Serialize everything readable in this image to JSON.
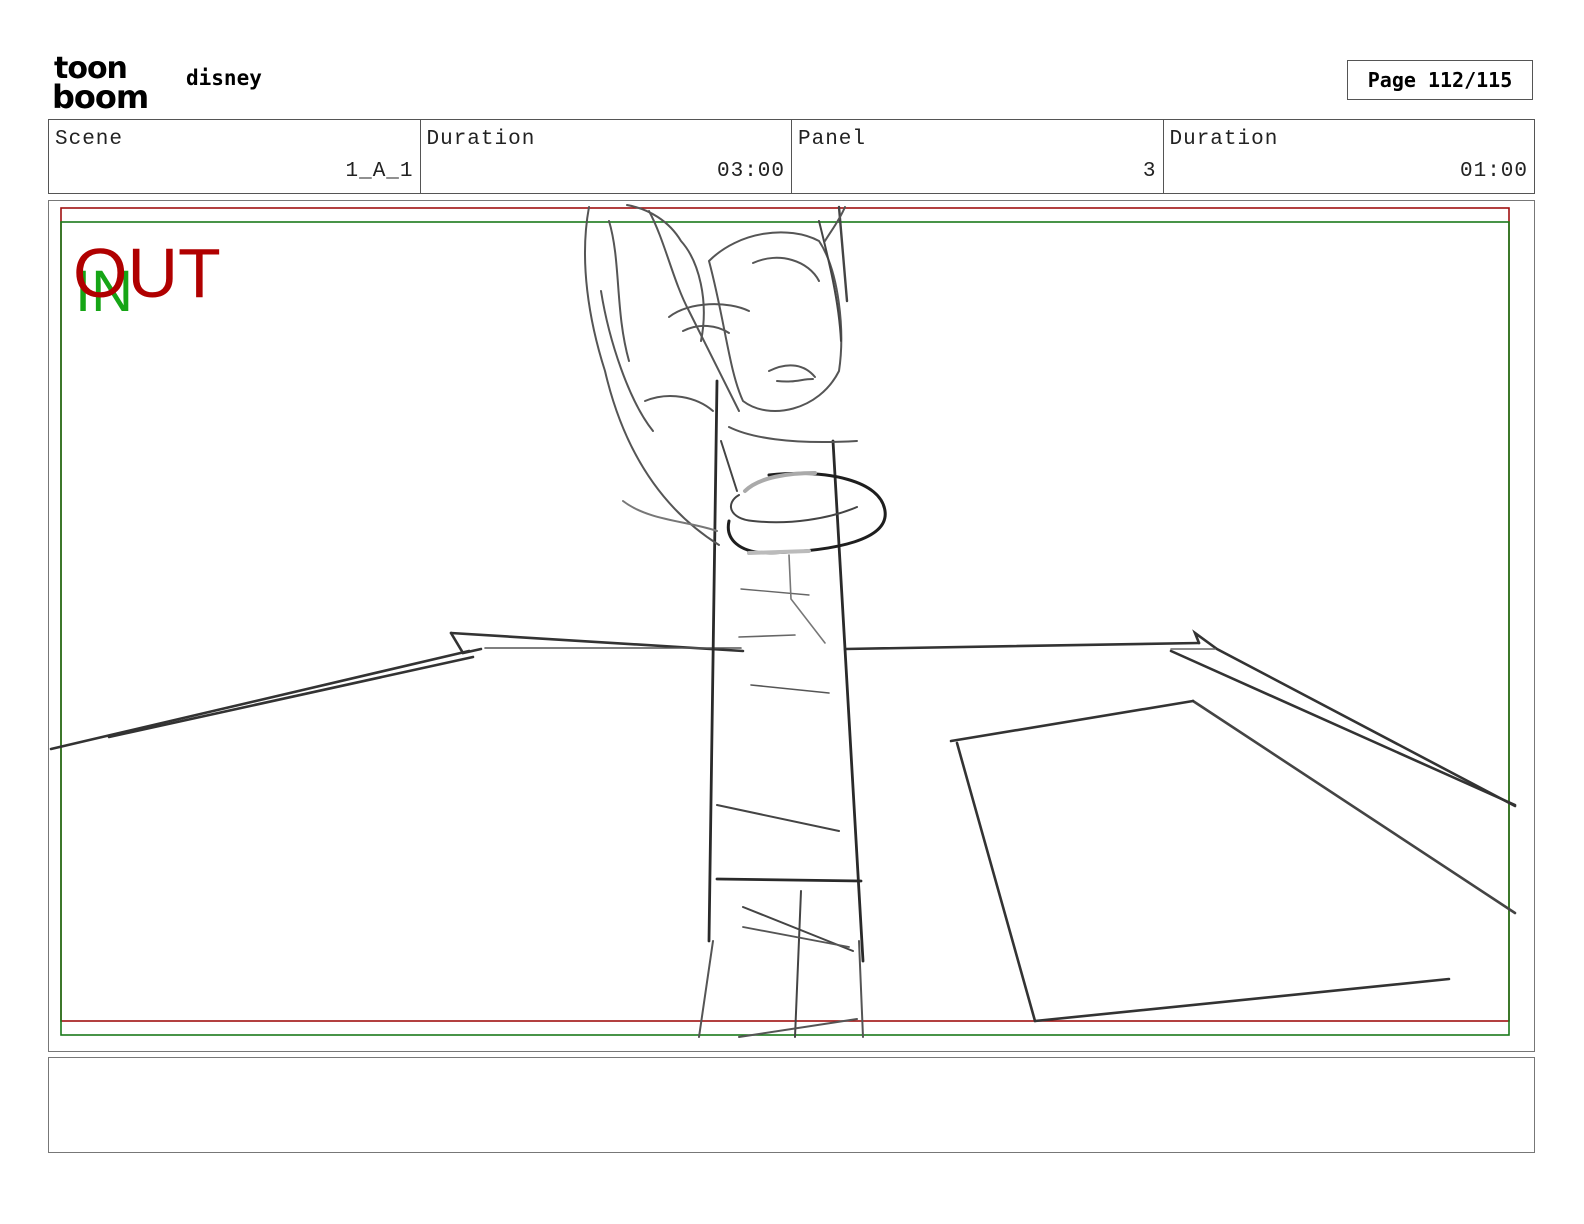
{
  "header": {
    "logo_top": "toon",
    "logo_bottom": "boom",
    "project_name": "disney",
    "page_label": "Page 112/115"
  },
  "info": {
    "scene_label": "Scene",
    "scene_value": "1_A_1",
    "scene_duration_label": "Duration",
    "scene_duration_value": "03:00",
    "panel_label": "Panel",
    "panel_value": "3",
    "panel_duration_label": "Duration",
    "panel_duration_value": "01:00"
  },
  "panel": {
    "overlay_out": "OUT",
    "overlay_in": "IN",
    "out_color": "#b00000",
    "in_color": "#16a516"
  },
  "notes": {
    "text": ""
  }
}
